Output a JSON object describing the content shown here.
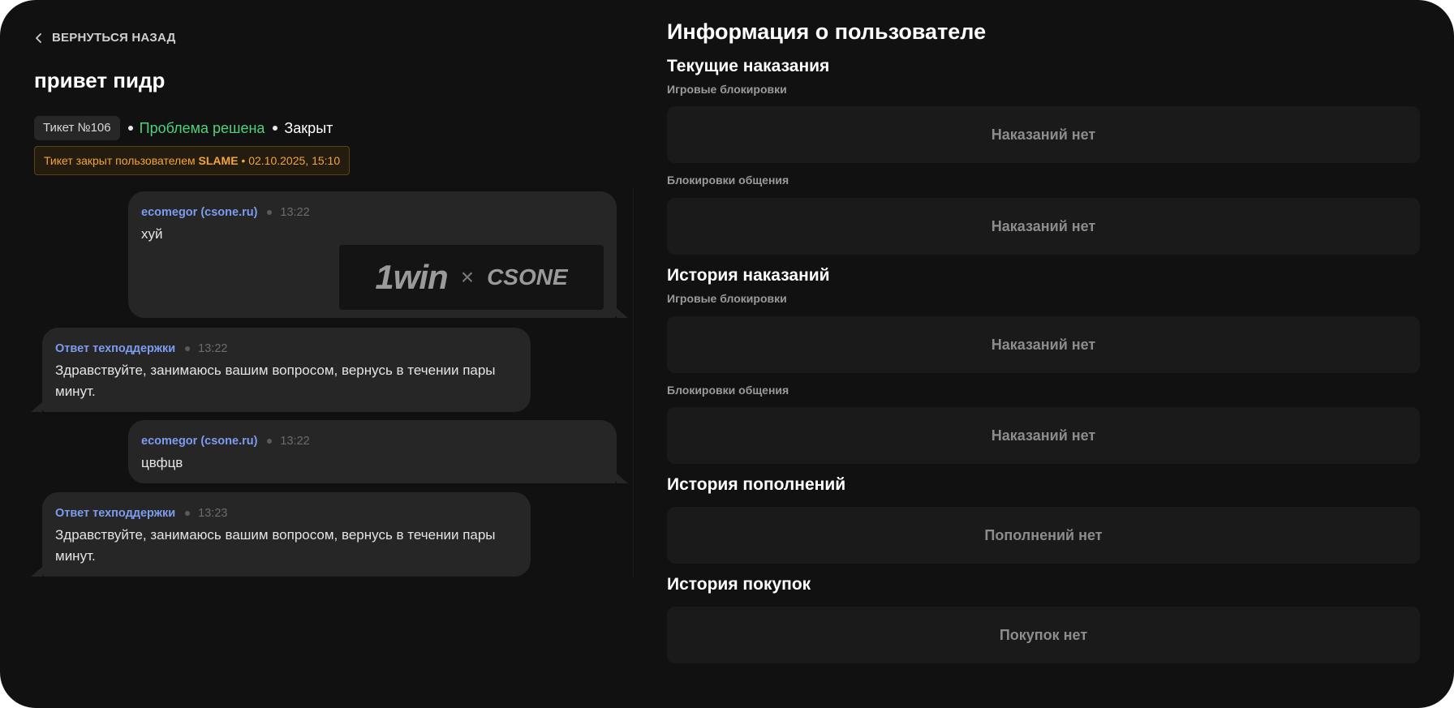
{
  "back": {
    "label": "ВЕРНУТЬСЯ НАЗАД"
  },
  "ticket": {
    "title": "привет пидр",
    "number_label": "Тикет №106",
    "status_resolution": "Проблема решена",
    "status_state": "Закрыт",
    "closed_prefix": "Тикет закрыт пользователем ",
    "closed_by": "SLAME",
    "closed_sep": " • ",
    "closed_at": "02.10.2025, 15:10"
  },
  "messages": [
    {
      "author": "ecomegor (csone.ru)",
      "time": "13:22",
      "text": "хуй",
      "side": "user"
    },
    {
      "author": "Ответ техподдержки",
      "time": "13:22",
      "text": "Здравствуйте, занимаюсь вашим вопросом, вернусь в течении пары минут.",
      "side": "support"
    },
    {
      "author": "ecomegor (csone.ru)",
      "time": "13:22",
      "text": "цвфцв",
      "side": "user"
    },
    {
      "author": "Ответ техподдержки",
      "time": "13:23",
      "text": "Здравствуйте, занимаюсь вашим вопросом, вернусь в течении пары минут.",
      "side": "support"
    }
  ],
  "attachment": {
    "brand_left": "1win",
    "separator": "×",
    "brand_right": "CSONE"
  },
  "user_info": {
    "title": "Информация о пользователе",
    "current_punishments": {
      "heading": "Текущие наказания",
      "game_label": "Игровые блокировки",
      "game_empty": "Наказаний нет",
      "chat_label": "Блокировки общения",
      "chat_empty": "Наказаний нет"
    },
    "punishment_history": {
      "heading": "История наказаний",
      "game_label": "Игровые блокировки",
      "game_empty": "Наказаний нет",
      "chat_label": "Блокировки общения",
      "chat_empty": "Наказаний нет"
    },
    "deposits": {
      "heading": "История пополнений",
      "empty": "Пополнений нет"
    },
    "purchases": {
      "heading": "История покупок",
      "empty": "Покупок нет"
    }
  },
  "colors": {
    "background": "#111111",
    "card": "#262626",
    "author": "#7d9cf0",
    "status_resolved": "#4fd17a",
    "banner_text": "#f3a43a"
  },
  "icons": {
    "back": "chevron-left-icon"
  }
}
